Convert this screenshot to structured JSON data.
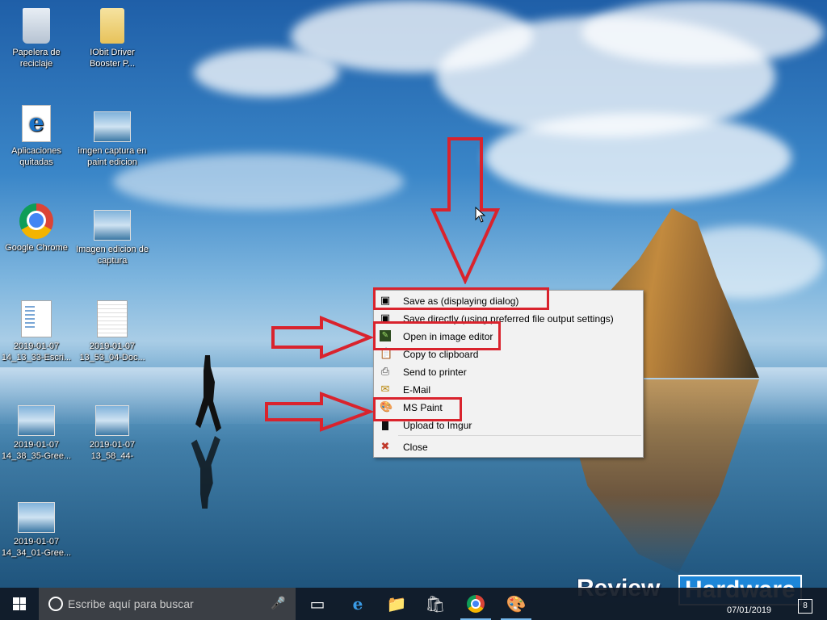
{
  "desktop": {
    "icons": [
      {
        "label": "Papelera de reciclaje",
        "icon": "recycle-bin-icon"
      },
      {
        "label": "IObit Driver Booster P...",
        "icon": "folder-icon"
      },
      {
        "label": "Aplicaciones quitadas",
        "icon": "edge-shortcut-icon"
      },
      {
        "label": "imgen captura en paint edicion",
        "icon": "image-file-icon"
      },
      {
        "label": "Google Chrome",
        "icon": "chrome-icon"
      },
      {
        "label": "Imagen edicion de captura",
        "icon": "image-file-icon"
      },
      {
        "label": "2019-01-07 14_13_33-Escri...",
        "icon": "screenshot-file-icon"
      },
      {
        "label": "2019-01-07 13_53_04-Doc...",
        "icon": "screenshot-file-icon"
      },
      {
        "label": "2019-01-07 14_38_35-Gree...",
        "icon": "image-file-icon"
      },
      {
        "label": "2019-01-07 13_58_44-",
        "icon": "image-file-icon"
      },
      {
        "label": "2019-01-07 14_34_01-Gree...",
        "icon": "image-file-icon"
      }
    ]
  },
  "context_menu": {
    "items": [
      {
        "label": "Save as (displaying dialog)",
        "icon": "floppy-disk-icon"
      },
      {
        "label": "Save directly (using preferred file output settings)",
        "icon": "floppy-disk-icon"
      },
      {
        "label": "Open in image editor",
        "icon": "image-editor-icon"
      },
      {
        "label": "Copy to clipboard",
        "icon": "clipboard-icon"
      },
      {
        "label": "Send to printer",
        "icon": "printer-icon"
      },
      {
        "label": "E-Mail",
        "icon": "email-icon"
      },
      {
        "label": "MS Paint",
        "icon": "paint-palette-icon"
      },
      {
        "label": "Upload to Imgur",
        "icon": "imgur-icon"
      },
      {
        "label": "Close",
        "icon": "close-icon"
      }
    ],
    "highlighted": [
      "Save as (displaying dialog)",
      "Open in image editor",
      "MS Paint"
    ]
  },
  "annotation_color": "#d9232d",
  "watermark": {
    "word1": "Review",
    "word2": "Hardware"
  },
  "taskbar": {
    "search_placeholder": "Escribe aquí para buscar",
    "apps": [
      "task-view-icon",
      "edge-icon",
      "file-explorer-icon",
      "store-icon",
      "chrome-icon",
      "paint-icon"
    ],
    "date": "07/01/2019",
    "notification_count": "8"
  }
}
